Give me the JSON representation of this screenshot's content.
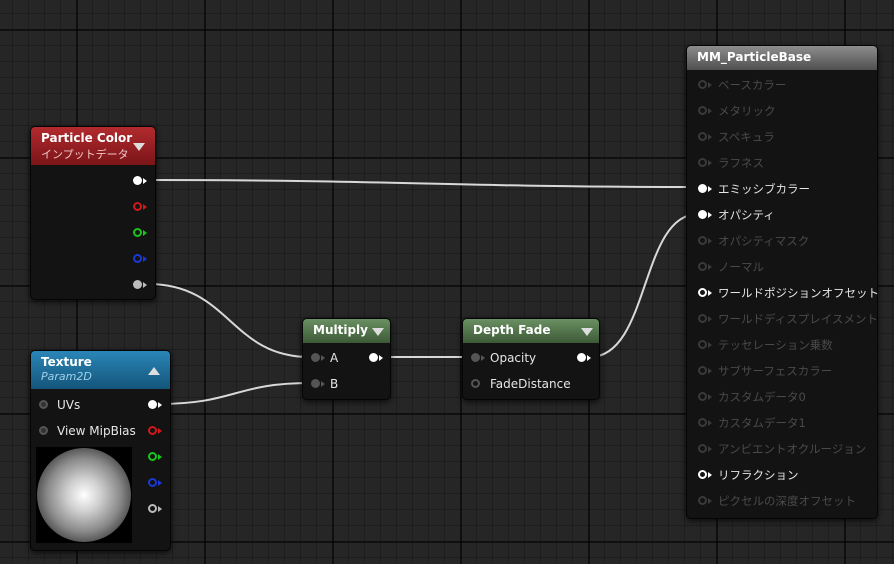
{
  "nodes": {
    "particle_color": {
      "title": "Particle Color",
      "subtitle": "インプットデータ",
      "header_color": "#8e1b1f"
    },
    "texture": {
      "title": "Texture",
      "subtitle": "Param2D",
      "header_color": "#1d6f9a",
      "inputs": [
        "UVs",
        "View MipBias"
      ]
    },
    "multiply": {
      "title": "Multiply",
      "header_color": "#4e6e47",
      "inputs": [
        "A",
        "B"
      ]
    },
    "depth_fade": {
      "title": "Depth Fade",
      "header_color": "#4e6e47",
      "inputs": [
        "Opacity",
        "FadeDistance"
      ]
    },
    "material": {
      "title": "MM_ParticleBase",
      "inputs": [
        {
          "label": "ベースカラー",
          "state": "disabled"
        },
        {
          "label": "メタリック",
          "state": "disabled"
        },
        {
          "label": "スペキュラ",
          "state": "disabled"
        },
        {
          "label": "ラフネス",
          "state": "disabled"
        },
        {
          "label": "エミッシブカラー",
          "state": "connected"
        },
        {
          "label": "オパシティ",
          "state": "connected"
        },
        {
          "label": "オパシティマスク",
          "state": "disabled"
        },
        {
          "label": "ノーマル",
          "state": "disabled"
        },
        {
          "label": "ワールドポジションオフセット",
          "state": "enabled"
        },
        {
          "label": "ワールドディスプレイスメント",
          "state": "disabled"
        },
        {
          "label": "テッセレーション乗数",
          "state": "disabled"
        },
        {
          "label": "サブサーフェスカラー",
          "state": "disabled"
        },
        {
          "label": "カスタムデータ0",
          "state": "disabled"
        },
        {
          "label": "カスタムデータ1",
          "state": "disabled"
        },
        {
          "label": "アンビエントオクルージョン",
          "state": "disabled"
        },
        {
          "label": "リフラクション",
          "state": "enabled"
        },
        {
          "label": "ピクセルの深度オフセット",
          "state": "disabled"
        }
      ]
    }
  },
  "pin_colors": {
    "rgb": "#ffffff",
    "r": "#d11919",
    "g": "#19c619",
    "b": "#1b39d6",
    "a": "#bbbbbb"
  }
}
